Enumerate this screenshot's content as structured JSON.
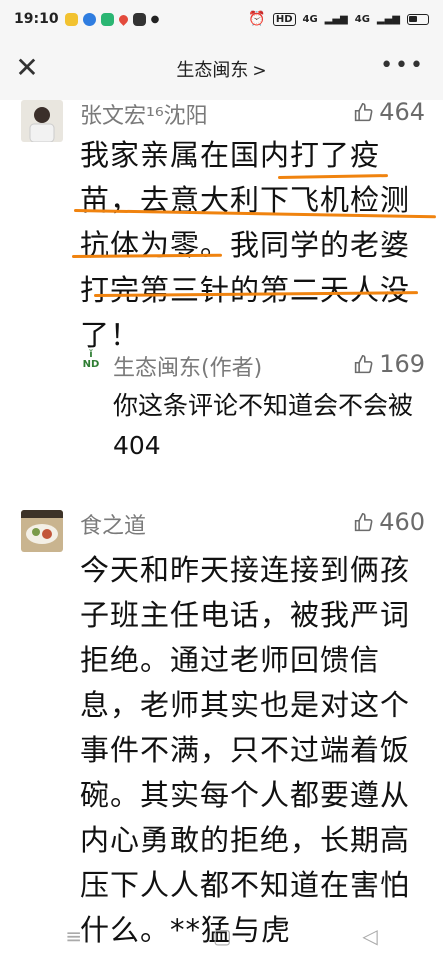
{
  "status_bar": {
    "time": "19:10",
    "right_labels": [
      "HD",
      "4G",
      "4G"
    ]
  },
  "header": {
    "close_icon": "close-icon",
    "title": "生态闽东",
    "chevron": ">",
    "more_icon": "more-icon"
  },
  "comments": [
    {
      "user": "张文宏¹⁶沈阳",
      "likes": "464",
      "text": "我家亲属在国内打了疫苗，去意大利下飞机检测抗体为零。我同学的老婆打完第三针的第二天人没了！",
      "highlight_color": "#f0830f"
    },
    {
      "reply_user": "生态闽东(作者)",
      "reply_likes": "169",
      "reply_text": "你这条评论不知道会不会被404"
    },
    {
      "user": "食之道",
      "likes": "460",
      "text": "今天和昨天接连接到俩孩子班主任电话，被我严词拒绝。通过老师回馈信息，老师其实也是对这个事件不满，只不过端着饭碗。其实每个人都要遵从内心勇敢的拒绝，长期高压下人人都不知道在害怕什么。**猛与虎"
    }
  ],
  "bottom_nav": {
    "menu_icon": "≡",
    "home_icon": "▢",
    "back_icon": "◁"
  }
}
